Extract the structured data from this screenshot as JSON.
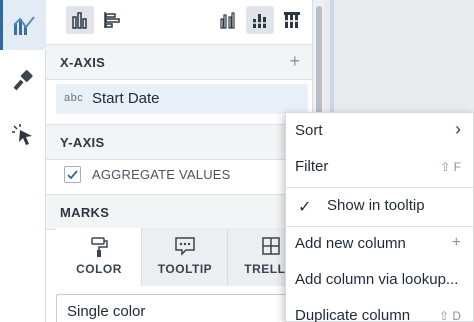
{
  "panel": {
    "x_axis": {
      "title": "X-AXIS",
      "add": "+",
      "field_type": "abc",
      "field_name": "Start Date"
    },
    "y_axis": {
      "title": "Y-AXIS",
      "aggregate_label": "AGGREGATE VALUES",
      "aggregate_checked": true
    },
    "marks": {
      "title": "MARKS",
      "tabs": [
        {
          "label": "COLOR",
          "icon": "paint-roller-icon"
        },
        {
          "label": "TOOLTIP",
          "icon": "tooltip-icon"
        },
        {
          "label": "TRELLIS",
          "icon": "trellis-icon"
        }
      ],
      "color_value": "Single color"
    }
  },
  "menu": {
    "sort": {
      "label": "Sort",
      "arrow": "›"
    },
    "filter": {
      "label": "Filter",
      "shortcut": "⇧ F"
    },
    "show_in_tooltip": {
      "label": "Show in tooltip",
      "check": "✓"
    },
    "add_new_column": {
      "label": "Add new column",
      "add": "+"
    },
    "add_column_lookup": {
      "label": "Add column via lookup..."
    },
    "duplicate_column": {
      "label": "Duplicate column",
      "shortcut": "⇧ D"
    }
  },
  "colors": {
    "accent": "#2a6ba8",
    "panel_header": "#f3f4f6",
    "field_bg": "#e9f0f8"
  }
}
